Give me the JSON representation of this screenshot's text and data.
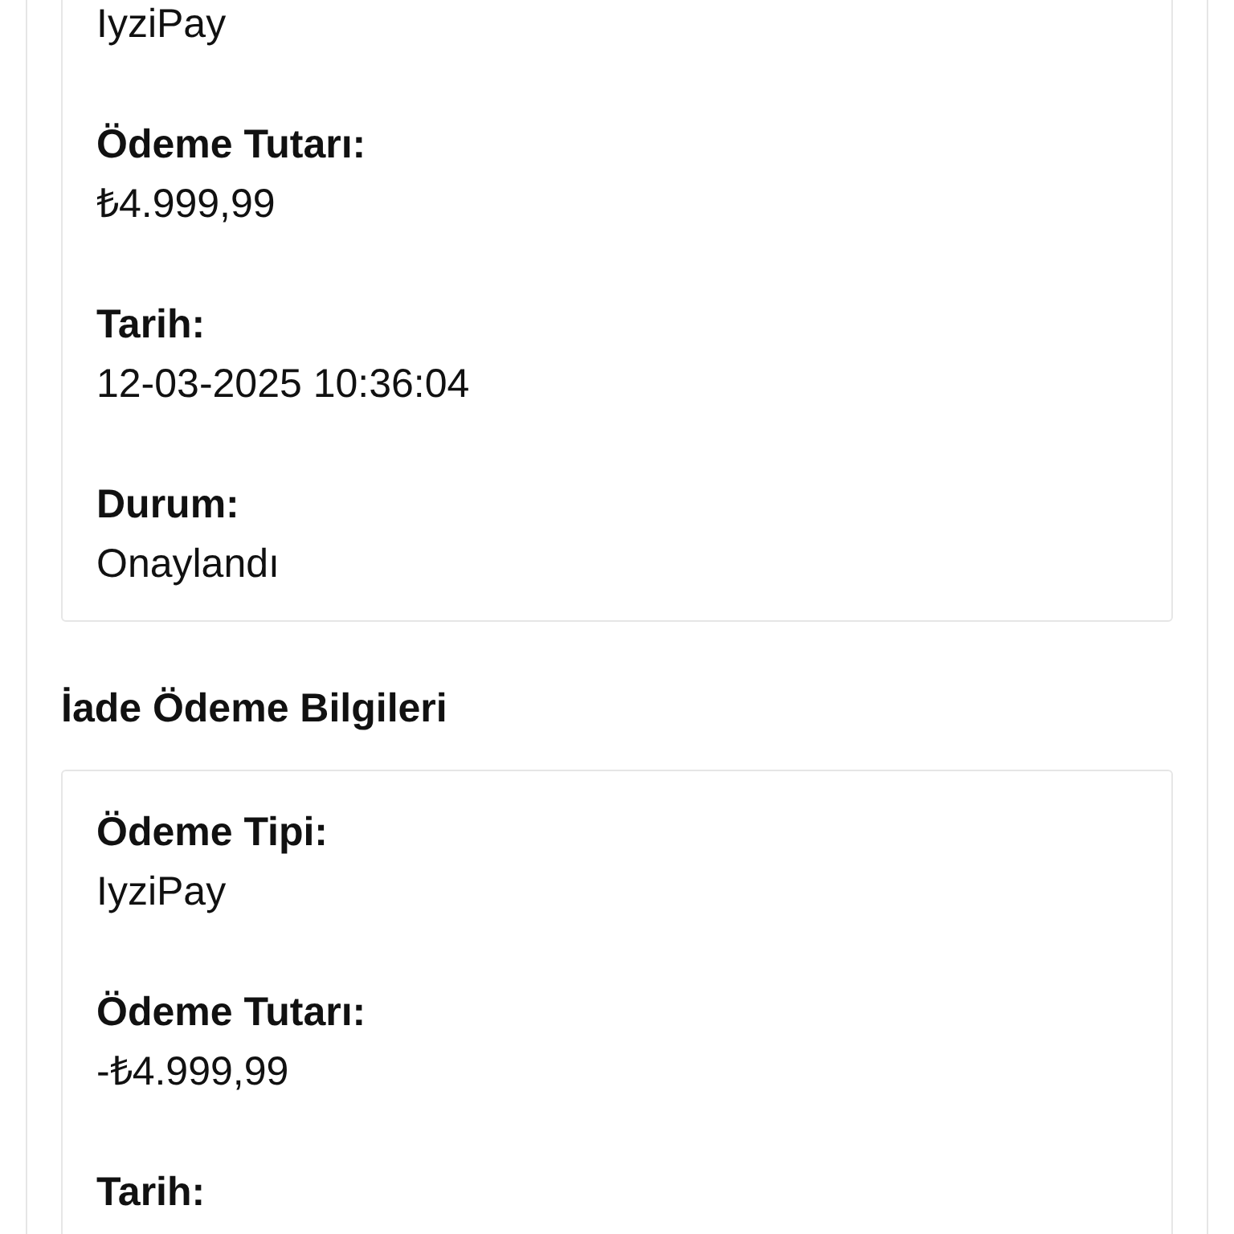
{
  "sections": [
    {
      "fields": [
        {
          "value": "IyziPay"
        },
        {
          "label": "Ödeme Tutarı:",
          "value": "₺4.999,99"
        },
        {
          "label": "Tarih:",
          "value": "12-03-2025 10:36:04"
        },
        {
          "label": "Durum:",
          "value": "Onaylandı"
        }
      ]
    },
    {
      "title": "İade Ödeme Bilgileri",
      "fields": [
        {
          "label": "Ödeme Tipi:",
          "value": "IyziPay"
        },
        {
          "label": "Ödeme Tutarı:",
          "value": "-₺4.999,99"
        },
        {
          "label": "Tarih:"
        }
      ]
    }
  ]
}
